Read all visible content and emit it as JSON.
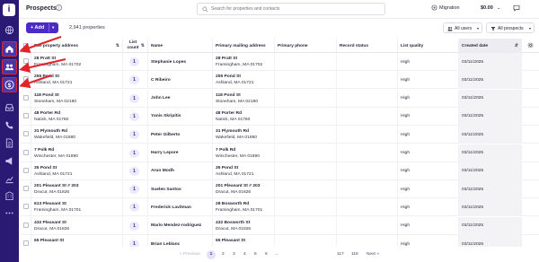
{
  "app": {
    "page_title": "Prospects",
    "search_placeholder": "Search for properties and contacts",
    "migration_label": "Migration",
    "balance": "$0.00",
    "avatar_initial": "I"
  },
  "sidebar": {
    "items": [
      {
        "icon": "globe-icon"
      },
      {
        "icon": "home-icon"
      },
      {
        "icon": "people-icon"
      },
      {
        "icon": "dollar-icon"
      },
      {
        "icon": "inbox-icon"
      },
      {
        "icon": "phone-icon"
      },
      {
        "icon": "document-icon"
      },
      {
        "icon": "megaphone-icon"
      },
      {
        "icon": "chart-icon"
      },
      {
        "icon": "building-icon"
      },
      {
        "icon": "more-icon"
      }
    ]
  },
  "toolbar": {
    "add_label": "Add",
    "property_count": "2,941 properties",
    "users_filter": "All users",
    "prospects_filter": "All prospects"
  },
  "table": {
    "columns": [
      "Full property address",
      "List count",
      "Name",
      "Primary mailing address",
      "Primary phone",
      "Record status",
      "List quality",
      "Created date"
    ],
    "rows": [
      {
        "prop1": "28 Pratt St",
        "prop2": "Framingham, MA 01702",
        "count": "1",
        "name": "Stephanie Lopes",
        "mail1": "28 Pratt St",
        "mail2": "Framingham, MA 01702",
        "phone": "",
        "status": "",
        "quality": "High",
        "created": "03/11/2025"
      },
      {
        "prop1": "255 Pond St",
        "prop2": "Ashland, MA 01721",
        "count": "1",
        "name": "C Ribeiro",
        "mail1": "255 Pond St",
        "mail2": "Ashland, MA 01721",
        "phone": "",
        "status": "",
        "quality": "High",
        "created": "03/11/2025"
      },
      {
        "prop1": "118 Pond St",
        "prop2": "Stoneham, MA 02180",
        "count": "1",
        "name": "John Lee",
        "mail1": "118 Pond St",
        "mail2": "Stoneham, MA 02180",
        "phone": "",
        "status": "",
        "quality": "High",
        "created": "03/11/2025"
      },
      {
        "prop1": "48 Porter Rd",
        "prop2": "Natick, MA 01760",
        "count": "1",
        "name": "Yanis Skripitis",
        "mail1": "48 Porter Rd",
        "mail2": "Natick, MA 01760",
        "phone": "",
        "status": "",
        "quality": "High",
        "created": "03/11/2025"
      },
      {
        "prop1": "31 Plymouth Rd",
        "prop2": "Wakefield, MA 01880",
        "count": "1",
        "name": "Peter Gilberto",
        "mail1": "31 Plymouth Rd",
        "mail2": "Wakefield, MA 01880",
        "phone": "",
        "status": "",
        "quality": "High",
        "created": "03/11/2025"
      },
      {
        "prop1": "7 Polk Rd",
        "prop2": "Winchester, MA 01890",
        "count": "1",
        "name": "Harry Lepore",
        "mail1": "7 Polk Rd",
        "mail2": "Winchester, MA 01890",
        "phone": "",
        "status": "",
        "quality": "High",
        "created": "03/11/2025"
      },
      {
        "prop1": "35 Pond St",
        "prop2": "Ashland, MA 01721",
        "count": "1",
        "name": "Arun Modh",
        "mail1": "35 Pond St",
        "mail2": "Ashland, MA 01721",
        "phone": "",
        "status": "",
        "quality": "High",
        "created": "03/11/2025"
      },
      {
        "prop1": "201 Pleasant St # 203",
        "prop2": "Dracut, MA 01826",
        "count": "1",
        "name": "Suelen Santos",
        "mail1": "201 Pleasant St # 203",
        "mail2": "Dracut, MA 01826",
        "phone": "",
        "status": "",
        "quality": "High",
        "created": "03/11/2025"
      },
      {
        "prop1": "613 Pleasant St",
        "prop2": "Framingham, MA 01701",
        "count": "1",
        "name": "Frederick Lavitman",
        "mail1": "28 Bosworth Rd",
        "mail2": "Framingham, MA 01701",
        "phone": "",
        "status": "",
        "quality": "High",
        "created": "03/11/2025"
      },
      {
        "prop1": "432 Pleasant St",
        "prop2": "Dracut, MA 01826",
        "count": "1",
        "name": "Mario Mendez-rodriguez",
        "mail1": "432 Bosworth St",
        "mail2": "Dracut, MA 01826",
        "phone": "",
        "status": "",
        "quality": "High",
        "created": "03/11/2025"
      },
      {
        "prop1": "65 Pleasant St",
        "prop2": "",
        "count": "1",
        "name": "Brian Leblanc",
        "mail1": "65 Pleasant St",
        "mail2": "",
        "phone": "",
        "status": "",
        "quality": "High",
        "created": "03/11/2025"
      }
    ]
  },
  "pagination": {
    "prev_label": "« Previous",
    "pages": [
      "1",
      "2",
      "3",
      "4",
      "5",
      "6",
      "...",
      "117",
      "118"
    ],
    "current": "1",
    "next_label": "Next »"
  },
  "colors": {
    "sidebar_bg": "#2b1a73",
    "accent": "#4b2ac8",
    "annotation_red": "#e0242a"
  }
}
